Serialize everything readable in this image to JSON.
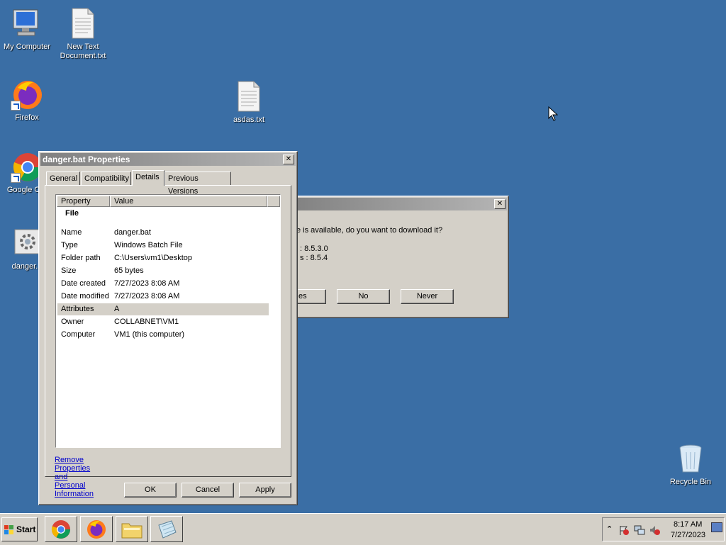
{
  "desktop": {
    "icons": [
      {
        "label": "My Computer"
      },
      {
        "label": "New Text Document.txt"
      },
      {
        "label": "Firefox"
      },
      {
        "label": "asdas.txt"
      },
      {
        "label": "Google Chr"
      },
      {
        "label": "danger.b"
      },
      {
        "label": "Recycle Bin"
      }
    ]
  },
  "update_dialog": {
    "message": "e is available, do you want to download it?",
    "line1": ": 8.5.3.0",
    "line2": "s : 8.5.4",
    "buttons": {
      "yes": "es",
      "no": "No",
      "never": "Never"
    }
  },
  "properties_dialog": {
    "title": "danger.bat Properties",
    "tabs": [
      "General",
      "Compatibility",
      "Details",
      "Previous Versions"
    ],
    "active_tab": "Details",
    "columns": {
      "property": "Property",
      "value": "Value"
    },
    "group": "File",
    "rows": [
      {
        "property": "Name",
        "value": "danger.bat"
      },
      {
        "property": "Type",
        "value": "Windows Batch File"
      },
      {
        "property": "Folder path",
        "value": "C:\\Users\\vm1\\Desktop"
      },
      {
        "property": "Size",
        "value": "65 bytes"
      },
      {
        "property": "Date created",
        "value": "7/27/2023 8:08 AM"
      },
      {
        "property": "Date modified",
        "value": "7/27/2023 8:08 AM"
      },
      {
        "property": "Attributes",
        "value": "A"
      },
      {
        "property": "Owner",
        "value": "COLLABNET\\VM1"
      },
      {
        "property": "Computer",
        "value": "VM1 (this computer)"
      }
    ],
    "link": "Remove Properties and Personal Information",
    "buttons": {
      "ok": "OK",
      "cancel": "Cancel",
      "apply": "Apply"
    }
  },
  "taskbar": {
    "start_label": "Start",
    "clock_time": "8:17 AM",
    "clock_date": "7/27/2023"
  }
}
